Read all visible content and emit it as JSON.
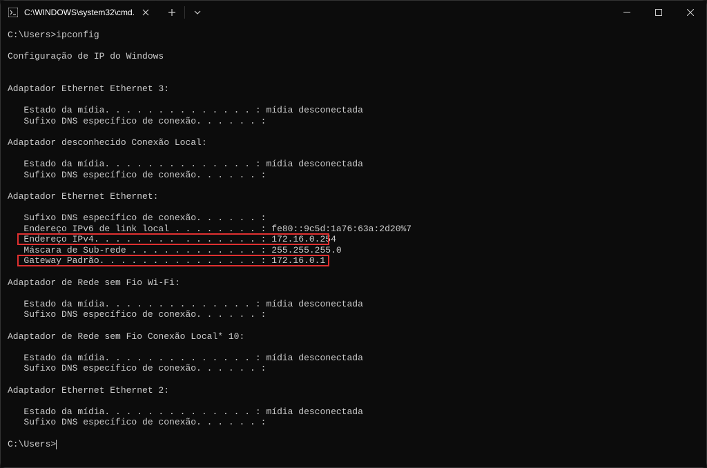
{
  "window": {
    "tab_title": "C:\\WINDOWS\\system32\\cmd.",
    "new_tab_tooltip": "+",
    "dropdown_tooltip": "˅"
  },
  "terminal": {
    "prompt1": "C:\\Users>ipconfig",
    "header": "Configuração de IP do Windows",
    "adapters": {
      "eth3": {
        "title": "Adaptador Ethernet Ethernet 3:",
        "media_state": "   Estado da mídia. . . . . . . . . . . . . . : mídia desconectada",
        "dns_suffix": "   Sufixo DNS específico de conexão. . . . . . :"
      },
      "unknown": {
        "title": "Adaptador desconhecido Conexão Local:",
        "media_state": "   Estado da mídia. . . . . . . . . . . . . . : mídia desconectada",
        "dns_suffix": "   Sufixo DNS específico de conexão. . . . . . :"
      },
      "eth": {
        "title": "Adaptador Ethernet Ethernet:",
        "dns_suffix": "   Sufixo DNS específico de conexão. . . . . . :",
        "ipv6": "   Endereço IPv6 de link local . . . . . . . . : fe80::9c5d:1a76:63a:2d20%7",
        "ipv4": "   Endereço IPv4. . . . . . . .  . . . . . . . : 172.16.0.254",
        "mask": "   Máscara de Sub-rede . . . . . . . . . . . . : 255.255.255.0",
        "gateway": "   Gateway Padrão. . . . . . . . . . . . . . . : 172.16.0.1"
      },
      "wifi": {
        "title": "Adaptador de Rede sem Fio Wi-Fi:",
        "media_state": "   Estado da mídia. . . . . . . . . . . . . . : mídia desconectada",
        "dns_suffix": "   Sufixo DNS específico de conexão. . . . . . :"
      },
      "local10": {
        "title": "Adaptador de Rede sem Fio Conexão Local* 10:",
        "media_state": "   Estado da mídia. . . . . . . . . . . . . . : mídia desconectada",
        "dns_suffix": "   Sufixo DNS específico de conexão. . . . . . :"
      },
      "eth2": {
        "title": "Adaptador Ethernet Ethernet 2:",
        "media_state": "   Estado da mídia. . . . . . . . . . . . . . : mídia desconectada",
        "dns_suffix": "   Sufixo DNS específico de conexão. . . . . . :"
      }
    },
    "prompt2": "C:\\Users>"
  },
  "highlight": {
    "color": "#e03030"
  }
}
